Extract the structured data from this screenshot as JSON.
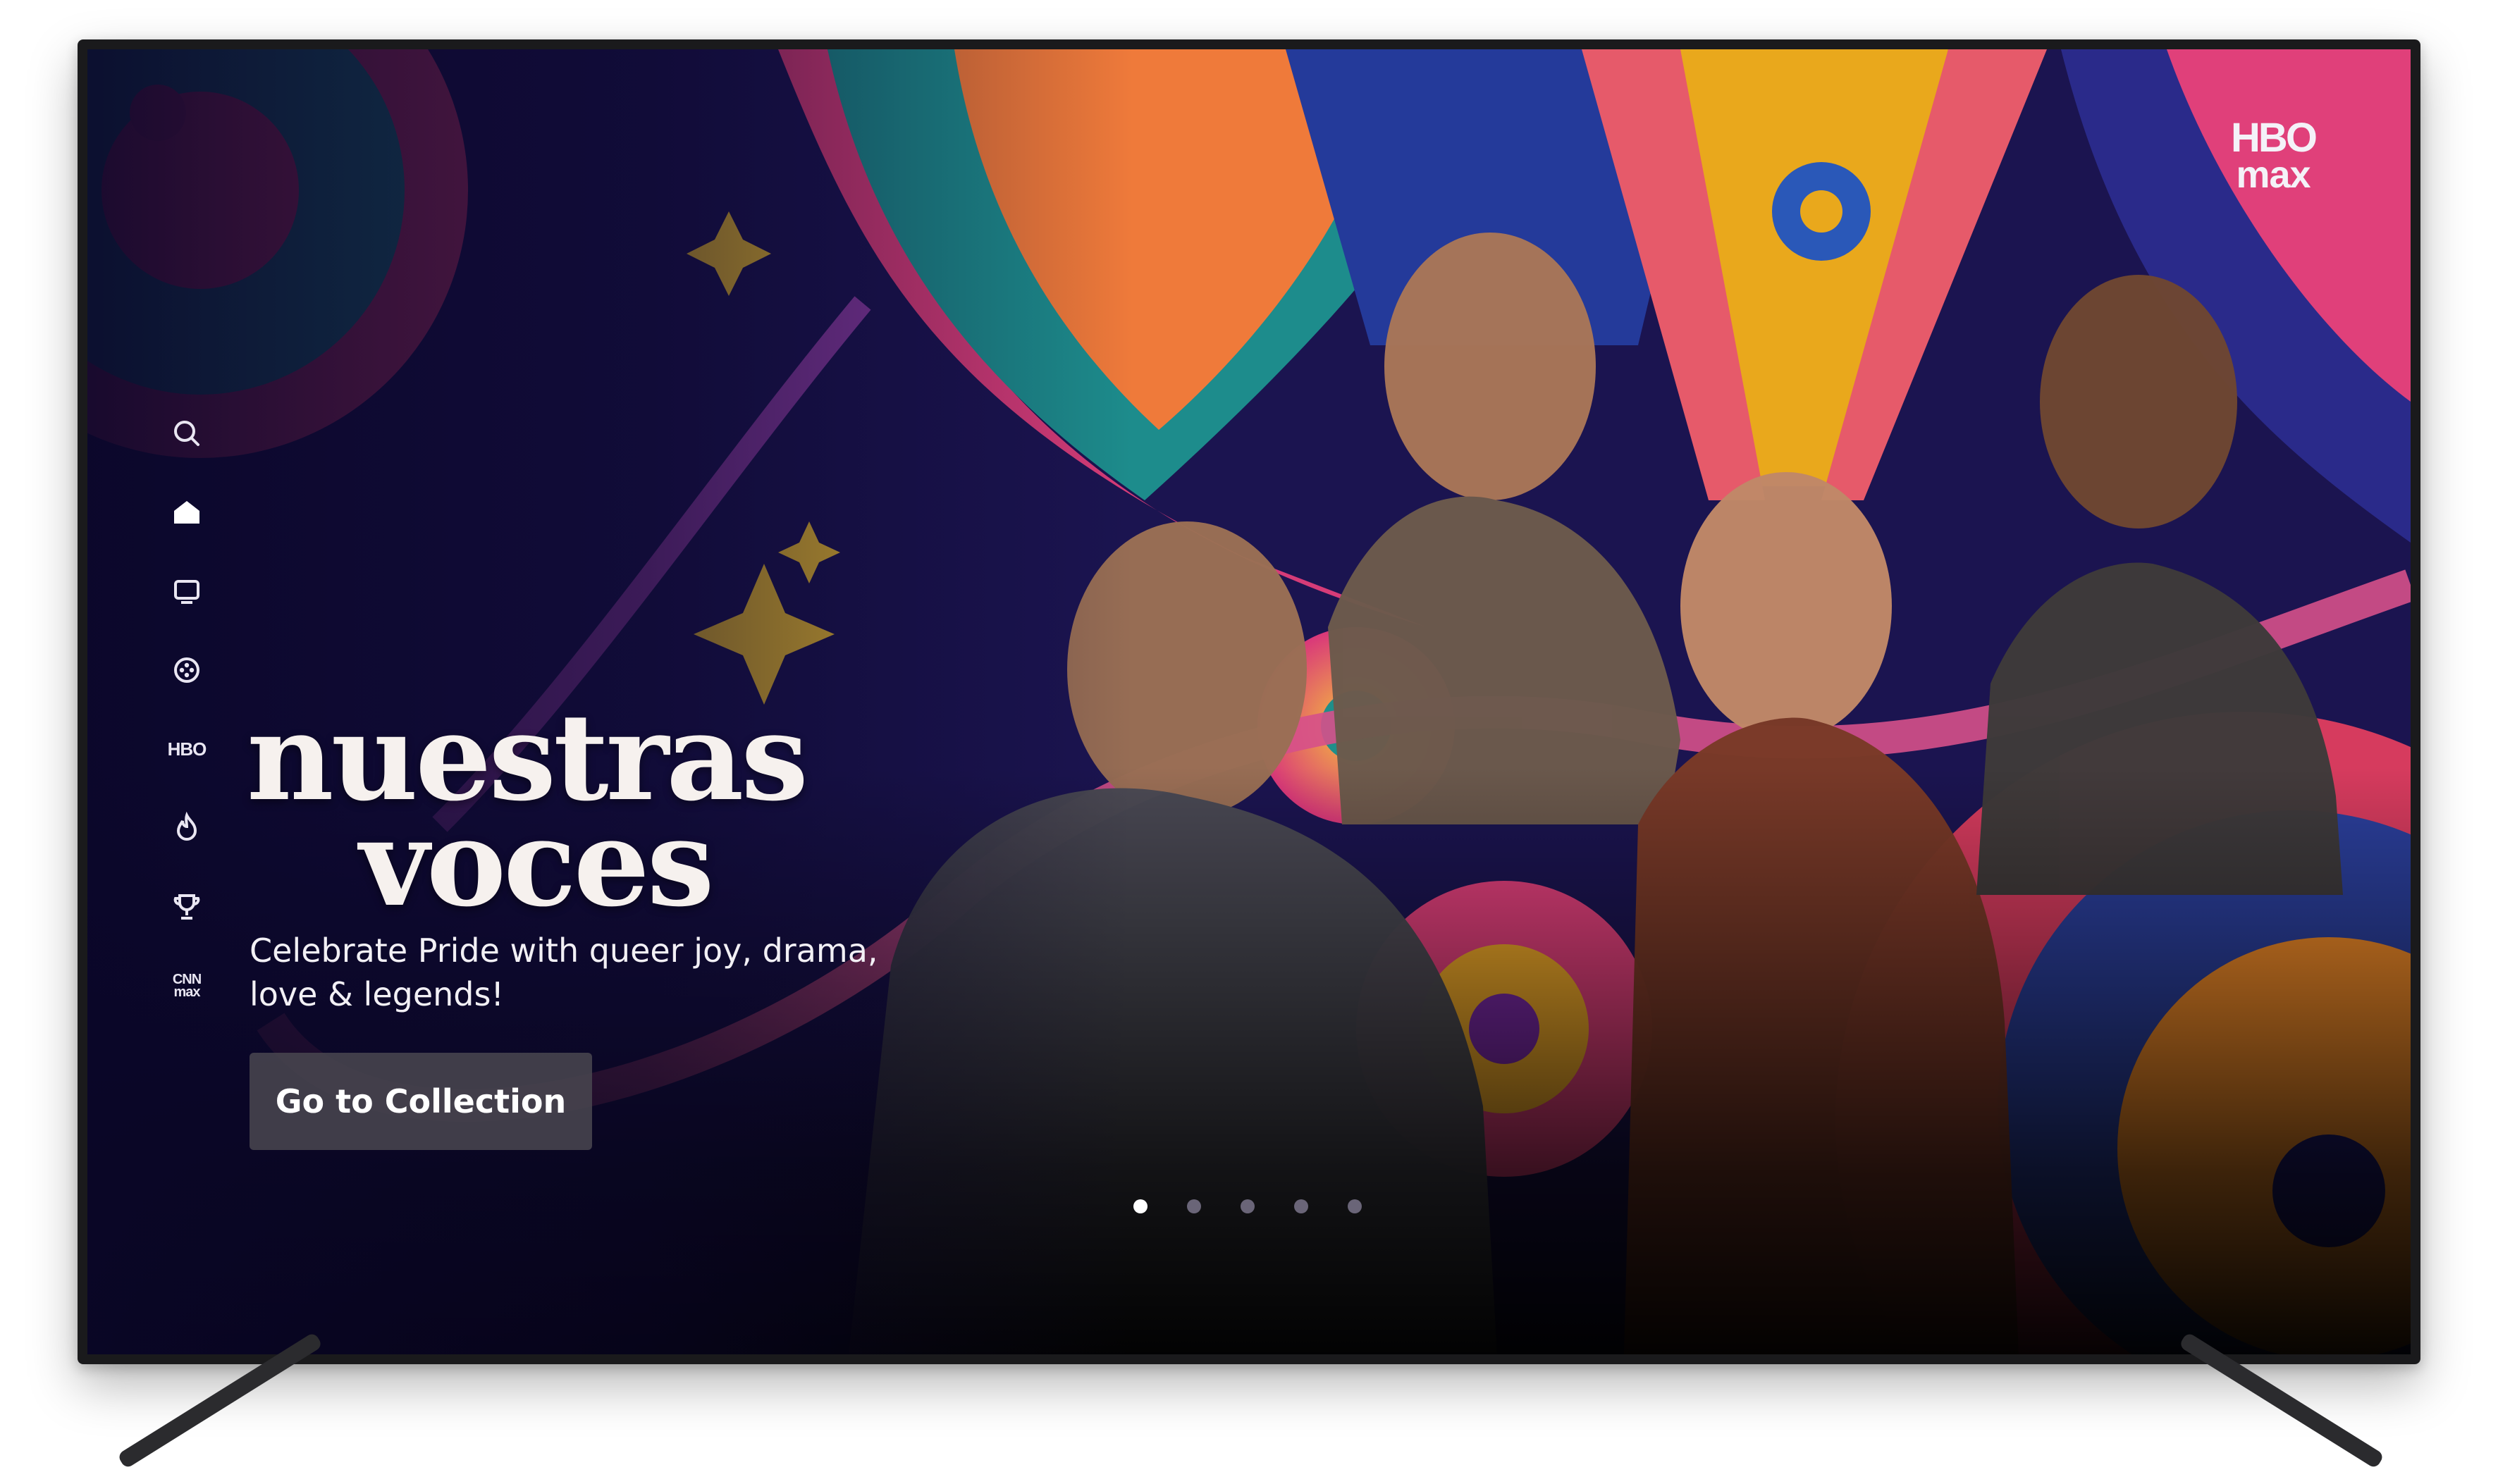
{
  "app": {
    "brand_line1": "HBO",
    "brand_line2": "max"
  },
  "sidenav": {
    "items": [
      {
        "name": "search",
        "icon": "search-icon"
      },
      {
        "name": "home",
        "icon": "home-icon",
        "active": true
      },
      {
        "name": "series",
        "icon": "tv-icon"
      },
      {
        "name": "movies",
        "icon": "film-reel-icon"
      },
      {
        "name": "hbo",
        "label": "HBO"
      },
      {
        "name": "new-and-hot",
        "icon": "flame-icon"
      },
      {
        "name": "awards",
        "icon": "trophy-icon"
      },
      {
        "name": "cnn-max",
        "label_line1": "CNN",
        "label_line2": "max"
      }
    ]
  },
  "hero": {
    "title_line1": "nuestras",
    "title_line2": "voces",
    "description_line1": "Celebrate Pride with queer joy, drama,",
    "description_line2": "love & legends!",
    "cta_label": "Go to Collection"
  },
  "pager": {
    "count": 5,
    "active_index": 0
  },
  "colors": {
    "background_purple": "#1b1450",
    "accent_pink": "#e0407a",
    "accent_orange": "#f07a3a",
    "accent_teal": "#1f8f8a",
    "accent_yellow": "#e9b21c"
  }
}
